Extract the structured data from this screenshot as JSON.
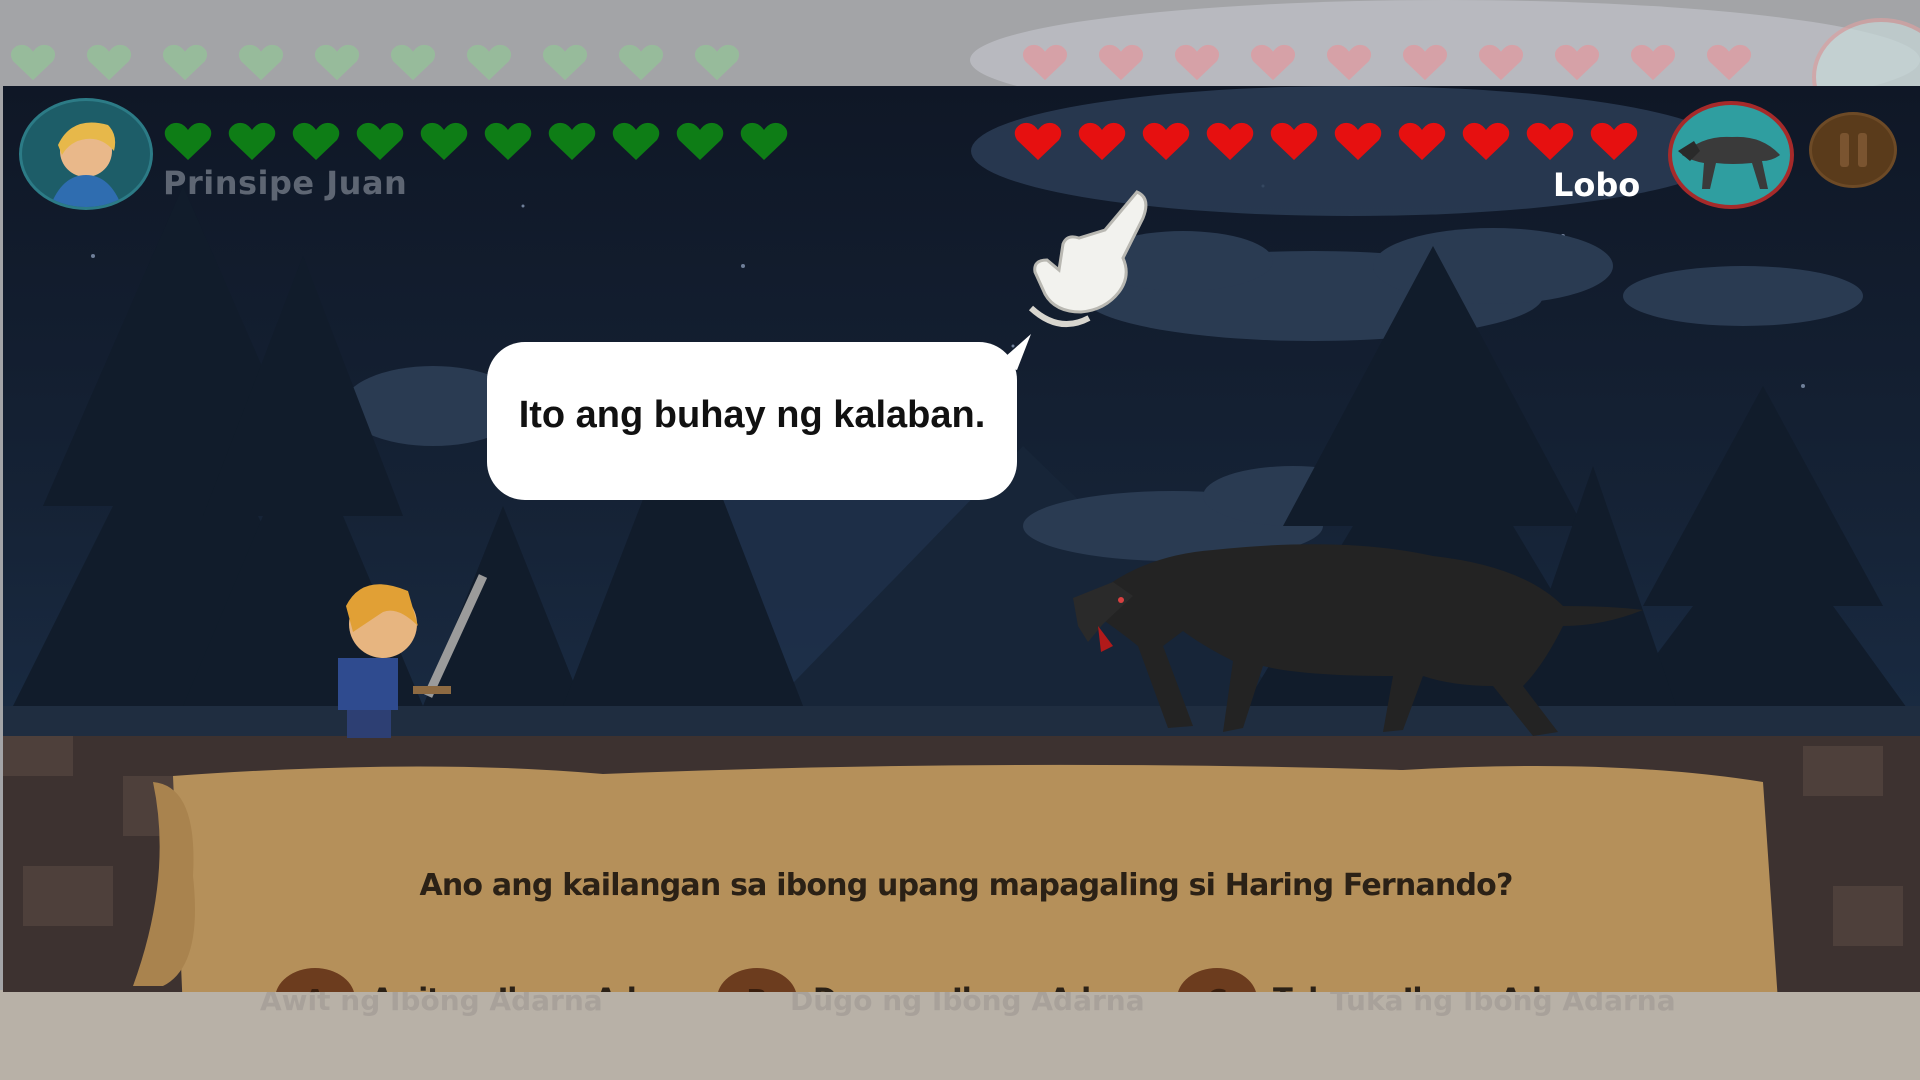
{
  "player": {
    "name": "Prinsipe Juan",
    "hearts": 10,
    "heart_color": "#0e7d16"
  },
  "enemy": {
    "name": "Lobo",
    "hearts": 10,
    "heart_color": "#e61010"
  },
  "tutorial": {
    "bubble_text": "Ito ang buhay ng kalaban.",
    "pointer": "hand-pointer-icon"
  },
  "question": {
    "text": "Ano ang kailangan sa ibong upang mapagaling si Haring Fernando?",
    "answers": [
      {
        "letter": "A",
        "text": "Awit ng Ibong Adarna"
      },
      {
        "letter": "B",
        "text": "Dugo ng Ibong Adarna"
      },
      {
        "letter": "C",
        "text": "Tuka ng Ibong Adarna"
      }
    ]
  },
  "ghost": {
    "answers": [
      {
        "letter": "A",
        "text": "Awit ng Ibong Adarna"
      },
      {
        "letter": "B",
        "text": "Dugo ng Ibong Adarna"
      },
      {
        "letter": "C",
        "text": "Tuka ng Ibong Adarna"
      }
    ]
  },
  "colors": {
    "scroll": "#b5905a",
    "badge": "#6c3c1e",
    "night_sky": "#152235"
  }
}
